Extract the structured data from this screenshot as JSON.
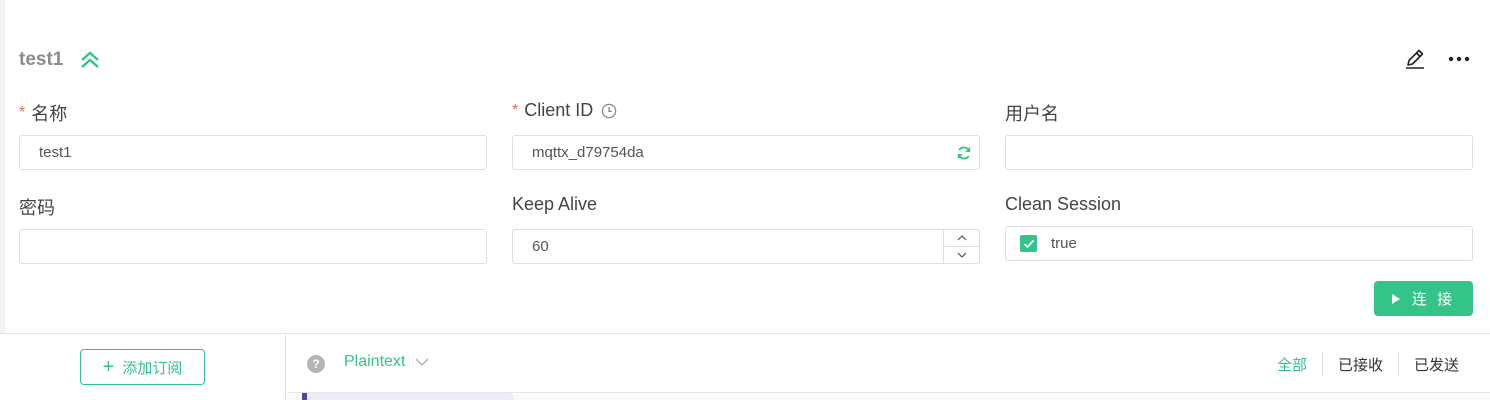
{
  "connection": {
    "name": "test1"
  },
  "form": {
    "name_label": "名称",
    "name_value": "test1",
    "client_id_label": "Client ID",
    "client_id_value": "mqttx_d79754da",
    "username_label": "用户名",
    "username_value": "",
    "password_label": "密码",
    "password_value": "",
    "keepalive_label": "Keep Alive",
    "keepalive_value": "60",
    "clean_session_label": "Clean Session",
    "clean_session_value": "true",
    "required_mark": "*"
  },
  "actions": {
    "connect_label": "连 接"
  },
  "subscriptions": {
    "add_label": "添加订阅",
    "plus": "+"
  },
  "messages": {
    "help": "?",
    "format": "Plaintext",
    "filters": [
      "全部",
      "已接收",
      "已发送"
    ],
    "active_filter": "全部"
  },
  "icons": {
    "collapse": "double-chevron-up-icon",
    "edit": "pencil-icon",
    "more": "more-icon",
    "history": "clock-icon",
    "refresh": "refresh-icon",
    "check": "check-icon",
    "play": "play-icon",
    "chevron": "chevron-down-icon"
  },
  "colors": {
    "accent": "#34c388",
    "required": "#e26c5c",
    "title": "#8c8c8c"
  }
}
